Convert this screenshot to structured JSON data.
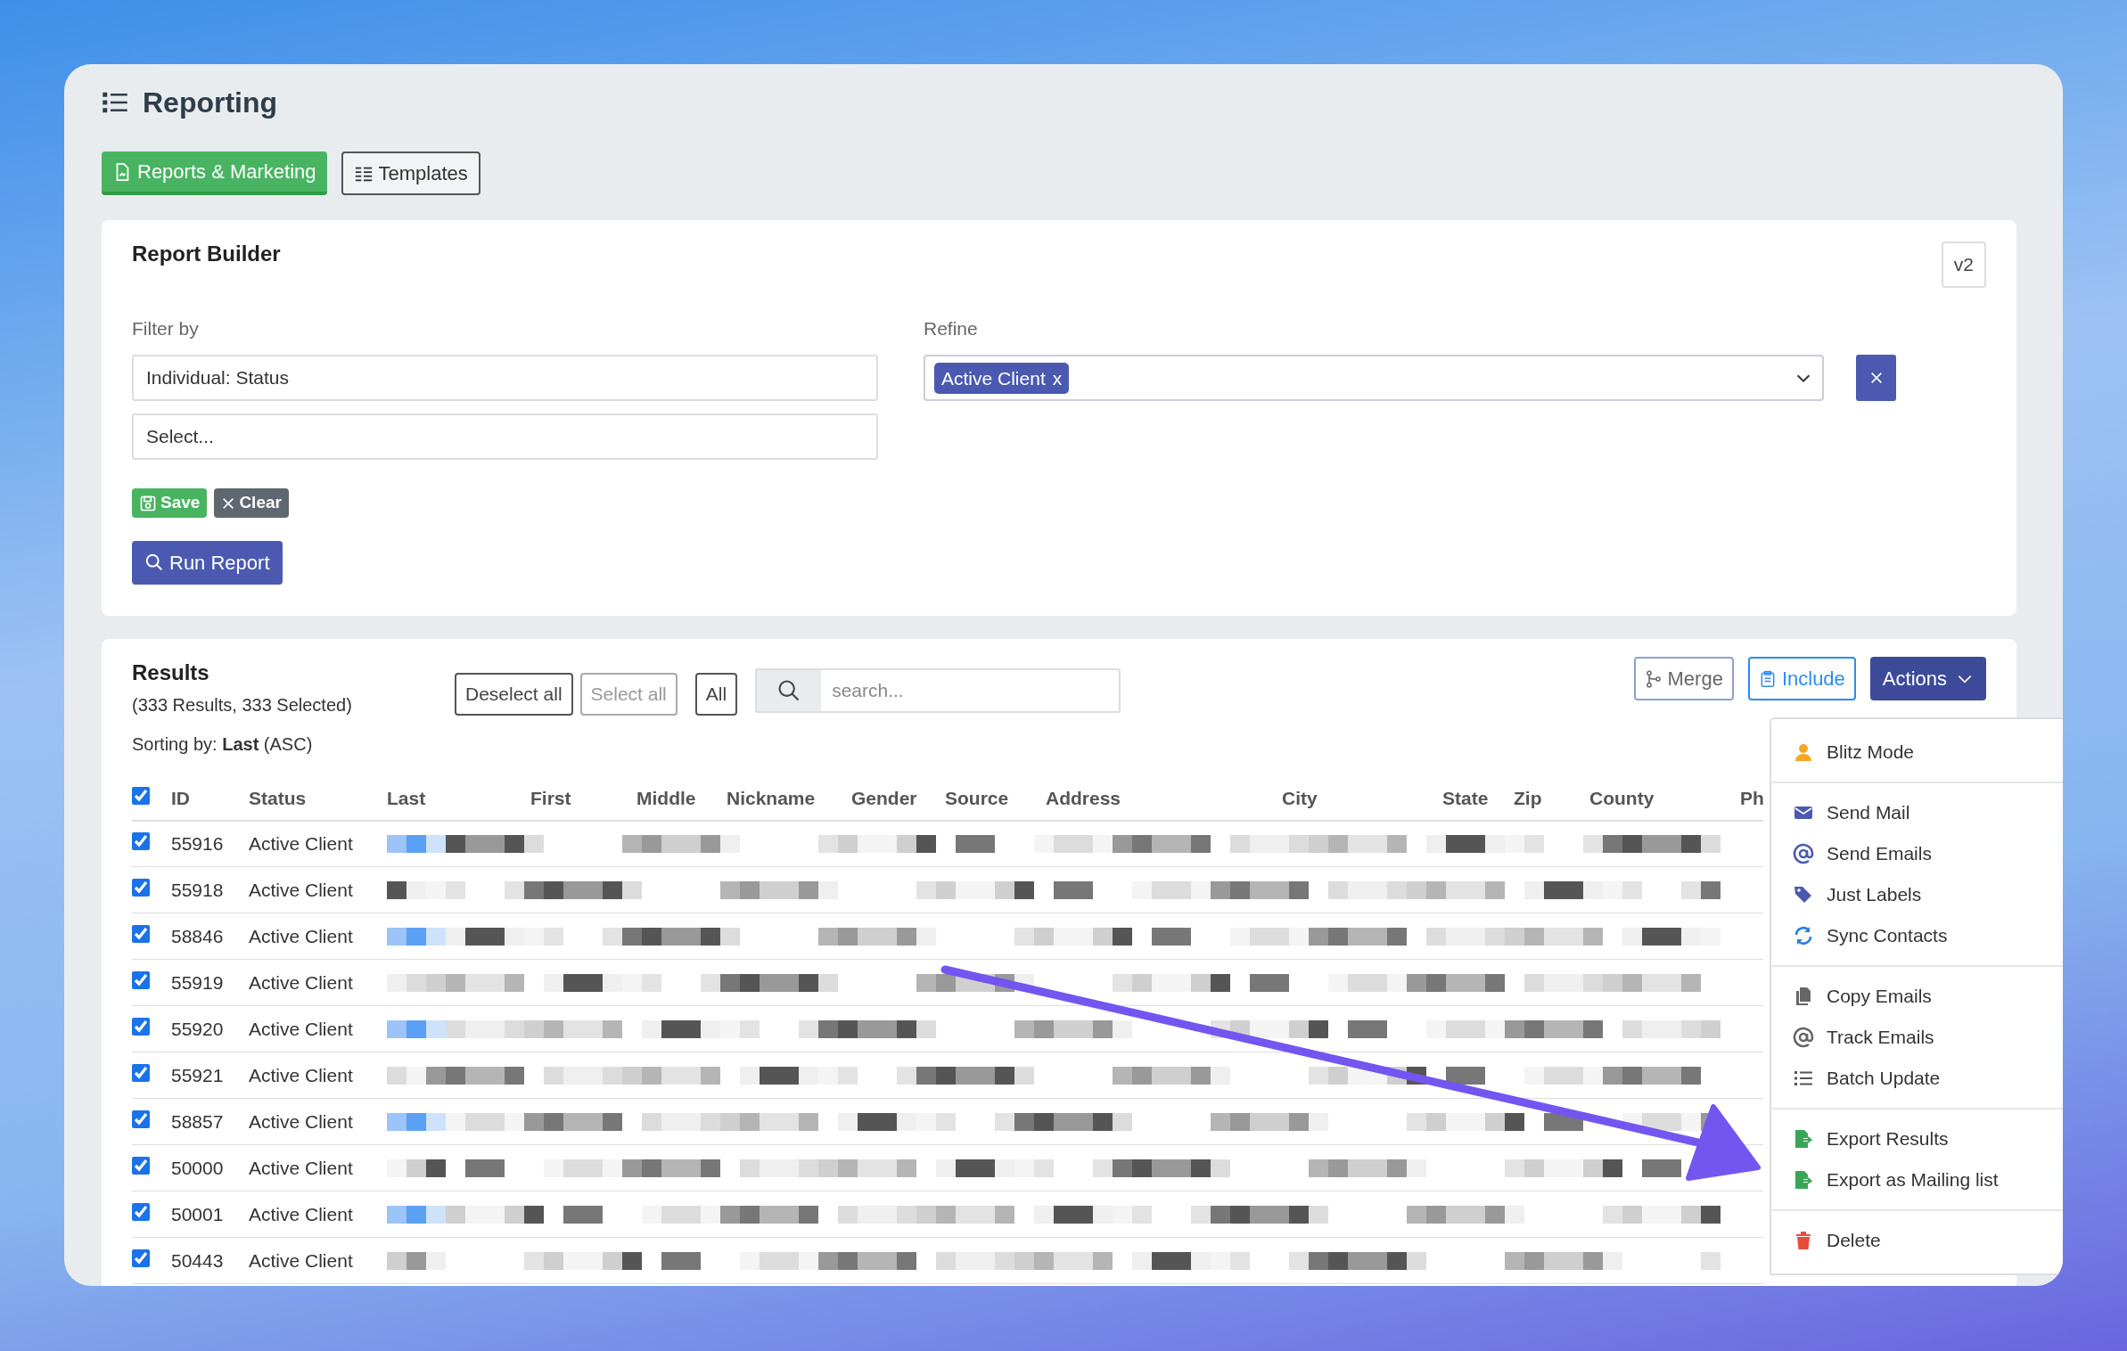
{
  "page": {
    "title": "Reporting"
  },
  "tabs": [
    {
      "label": "Reports & Marketing",
      "selected": true
    },
    {
      "label": "Templates",
      "selected": false
    }
  ],
  "report_builder": {
    "title": "Report Builder",
    "version_button": "v2",
    "filter_label": "Filter by",
    "filter_value": "Individual: Status",
    "select_placeholder": "Select...",
    "refine_label": "Refine",
    "refine_tags": [
      {
        "label": "Active Client",
        "remove": "x"
      }
    ],
    "save_button": "Save",
    "clear_button": "Clear",
    "run_button": "Run Report"
  },
  "results": {
    "title": "Results",
    "summary": "(333 Results, 333 Selected)",
    "sorting": "Sorting by: **Last** (ASC)",
    "deselect_button": "Deselect all",
    "select_all_button": "Select all",
    "select_all_disabled": true,
    "all_button": "All",
    "search_placeholder": "search...",
    "merge_button": "Merge",
    "include_button": "Include",
    "actions_button": "Actions",
    "actions_expanded": true
  },
  "table": {
    "all_checked": true,
    "columns": [
      "ID",
      "Status",
      "Last",
      "First",
      "Middle",
      "Nickname",
      "Gender",
      "Source",
      "Address",
      "City",
      "State",
      "Zip",
      "County",
      "Ph"
    ],
    "rows": [
      {
        "id": "55916",
        "status": "Active Client",
        "checked": true
      },
      {
        "id": "55918",
        "status": "Active Client",
        "checked": true
      },
      {
        "id": "58846",
        "status": "Active Client",
        "checked": true
      },
      {
        "id": "55919",
        "status": "Active Client",
        "checked": true
      },
      {
        "id": "55920",
        "status": "Active Client",
        "checked": true
      },
      {
        "id": "55921",
        "status": "Active Client",
        "checked": true
      },
      {
        "id": "58857",
        "status": "Active Client",
        "checked": true
      },
      {
        "id": "50000",
        "status": "Active Client",
        "checked": true
      },
      {
        "id": "50001",
        "status": "Active Client",
        "checked": true
      },
      {
        "id": "50443",
        "status": "Active Client",
        "checked": true
      }
    ]
  },
  "actions_menu": {
    "groups": [
      {
        "items": [
          {
            "label": "Blitz Mode"
          }
        ]
      },
      {
        "items": [
          {
            "label": "Send Mail"
          },
          {
            "label": "Send Emails"
          },
          {
            "label": "Just Labels"
          },
          {
            "label": "Sync Contacts"
          }
        ]
      },
      {
        "items": [
          {
            "label": "Copy Emails"
          },
          {
            "label": "Track Emails"
          },
          {
            "label": "Batch Update"
          }
        ]
      },
      {
        "items": [
          {
            "label": "Export Results"
          },
          {
            "label": "Export as Mailing list"
          }
        ]
      },
      {
        "items": [
          {
            "label": "Delete"
          }
        ]
      }
    ]
  }
}
